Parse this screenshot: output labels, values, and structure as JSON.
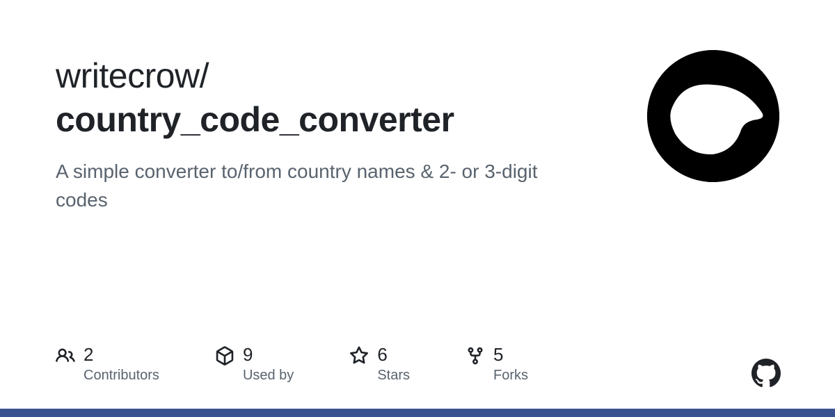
{
  "repo": {
    "owner": "writecrow",
    "separator": "/",
    "name": "country_code_converter",
    "description": "A simple converter to/from country names & 2- or 3-digit codes"
  },
  "stats": [
    {
      "icon": "people",
      "value": "2",
      "label": "Contributors"
    },
    {
      "icon": "package",
      "value": "9",
      "label": "Used by"
    },
    {
      "icon": "star",
      "value": "6",
      "label": "Stars"
    },
    {
      "icon": "fork",
      "value": "5",
      "label": "Forks"
    }
  ]
}
